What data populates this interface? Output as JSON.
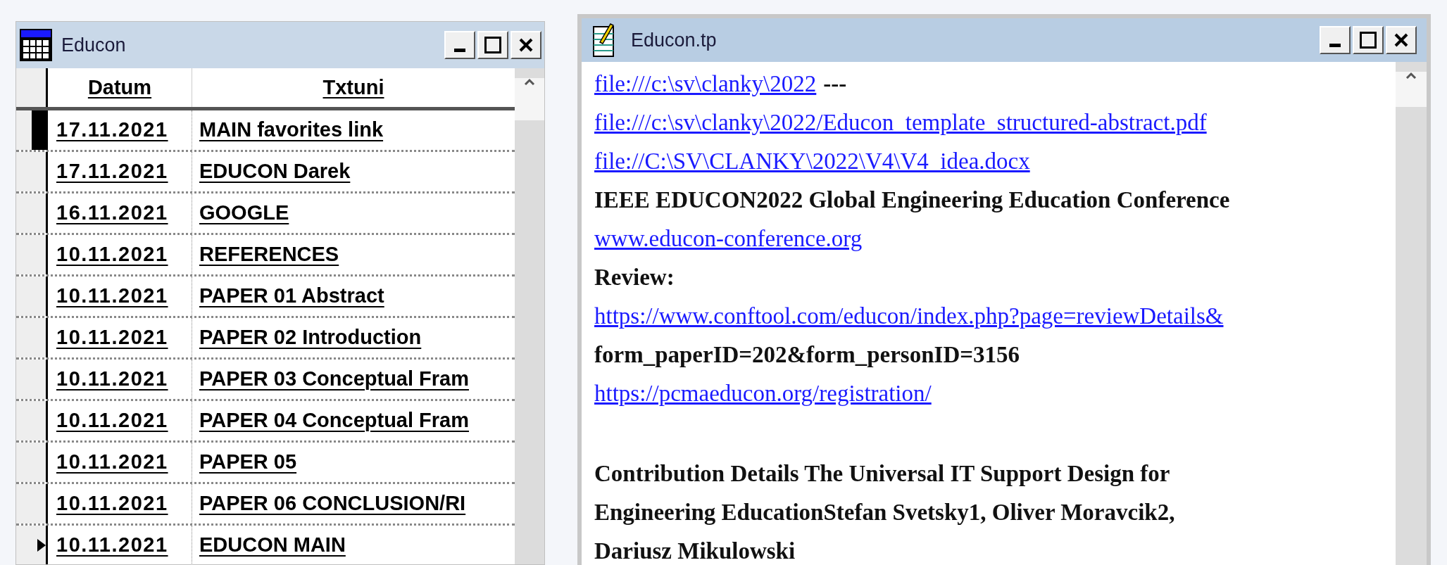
{
  "left_window": {
    "title": "Educon",
    "columns": [
      "Datum",
      "Txtuni"
    ],
    "rows": [
      {
        "datum": "17.11.2021",
        "txtuni": "MAIN favorites link",
        "current": true,
        "pointer": false
      },
      {
        "datum": "17.11.2021",
        "txtuni": "EDUCON Darek",
        "current": false,
        "pointer": false
      },
      {
        "datum": "16.11.2021",
        "txtuni": "GOOGLE",
        "current": false,
        "pointer": false
      },
      {
        "datum": "10.11.2021",
        "txtuni": "REFERENCES",
        "current": false,
        "pointer": false
      },
      {
        "datum": "10.11.2021",
        "txtuni": "PAPER 01 Abstract",
        "current": false,
        "pointer": false
      },
      {
        "datum": "10.11.2021",
        "txtuni": "PAPER 02 Introduction",
        "current": false,
        "pointer": false
      },
      {
        "datum": "10.11.2021",
        "txtuni": "PAPER 03 Conceptual Fram",
        "current": false,
        "pointer": false
      },
      {
        "datum": "10.11.2021",
        "txtuni": "PAPER 04 Conceptual Fram",
        "current": false,
        "pointer": false
      },
      {
        "datum": "10.11.2021",
        "txtuni": "PAPER 05",
        "current": false,
        "pointer": false
      },
      {
        "datum": "10.11.2021",
        "txtuni": "PAPER 06 CONCLUSION/RI",
        "current": false,
        "pointer": false
      },
      {
        "datum": "10.11.2021",
        "txtuni": "EDUCON MAIN",
        "current": false,
        "pointer": true
      }
    ]
  },
  "right_window": {
    "title": "Educon.tp",
    "lines": [
      {
        "kind": "link",
        "text": "file:///c:\\sv\\clanky\\2022",
        "after": "---"
      },
      {
        "kind": "link",
        "text": "file:///c:\\sv\\clanky\\2022/Educon_template_structured-abstract.pdf"
      },
      {
        "kind": "link",
        "text": "file://C:\\SV\\CLANKY\\2022\\V4\\V4_idea.docx"
      },
      {
        "kind": "bold",
        "text": "IEEE EDUCON2022 Global Engineering Education Conference"
      },
      {
        "kind": "link",
        "text": "www.educon-conference.org"
      },
      {
        "kind": "bold",
        "text": "Review:"
      },
      {
        "kind": "link",
        "text": "https://www.conftool.com/educon/index.php?page=reviewDetails&"
      },
      {
        "kind": "bold",
        "text": "form_paperID=202&form_personID=3156"
      },
      {
        "kind": "link",
        "text": "https://pcmaeducon.org/registration/"
      },
      {
        "kind": "paragraph",
        "text": [
          "Contribution Details The Universal IT Support Design for",
          "Engineering EducationStefan Svetsky1, Oliver Moravcik2,",
          "Dariusz Mikulowski"
        ]
      }
    ]
  }
}
